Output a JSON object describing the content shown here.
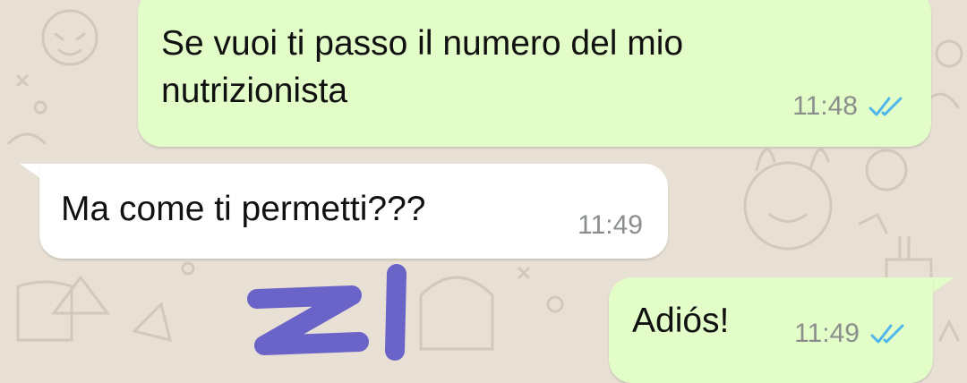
{
  "chat": {
    "messages": [
      {
        "direction": "outgoing",
        "text": "Se vuoi ti passo il numero del mio nutrizionista",
        "time": "11:48",
        "status": "read"
      },
      {
        "direction": "incoming",
        "text": "Ma come ti permetti???",
        "time": "11:49"
      },
      {
        "direction": "outgoing",
        "text": "Adiós!",
        "time": "11:49",
        "status": "read"
      }
    ],
    "annotation": "ZI"
  },
  "colors": {
    "wallpaper": "#e8e0d4",
    "outgoing_bubble": "#e2fdc8",
    "incoming_bubble": "#ffffff",
    "read_ticks": "#4fb6ec",
    "annotation_ink": "#6a63c8",
    "timestamp": "#8a8f8c"
  },
  "icons": {
    "read_receipt": "double-check-icon"
  }
}
